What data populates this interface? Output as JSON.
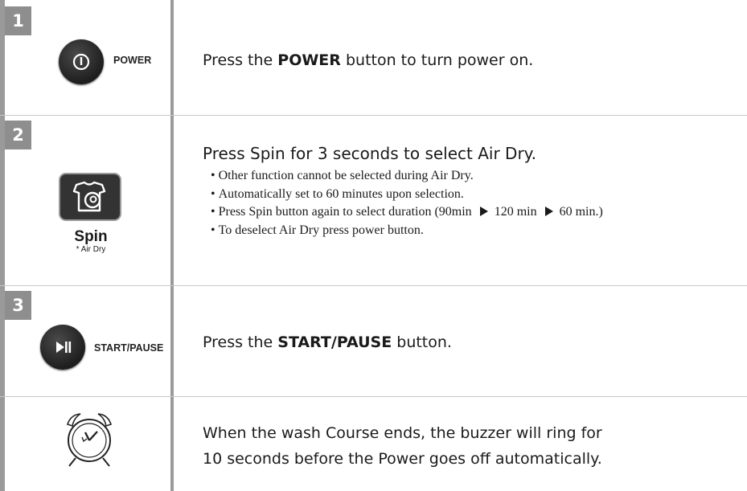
{
  "steps": [
    {
      "number": "1",
      "button_label": "POWER",
      "text_prefix": "Press the ",
      "text_bold": "POWER",
      "text_suffix": " button to turn power on."
    },
    {
      "number": "2",
      "button_label": "Spin",
      "button_sublabel": "* Air Dry",
      "text": "Press Spin for 3 seconds to select Air Dry.",
      "bullets": [
        "Other function cannot be selected during Air Dry.",
        "Automatically set to 60 minutes upon selection.",
        "To deselect Air Dry press power button."
      ],
      "duration_bullet": {
        "prefix": "Press Spin button again to select duration (90min",
        "mid": "120 min",
        "end": "60 min.)"
      }
    },
    {
      "number": "3",
      "button_label": "START/PAUSE",
      "text_prefix": "Press the ",
      "text_bold": "START/PAUSE",
      "text_suffix": " button."
    }
  ],
  "end_note": {
    "icon": "alarm-clock-icon",
    "line1": "When the wash Course ends, the buzzer will ring for",
    "line2": "10 seconds before the Power goes off automatically."
  },
  "colors": {
    "step_badge": "#8e8e8e",
    "button_dark": "#2a2a2a",
    "divider": "#c8c8c8"
  }
}
